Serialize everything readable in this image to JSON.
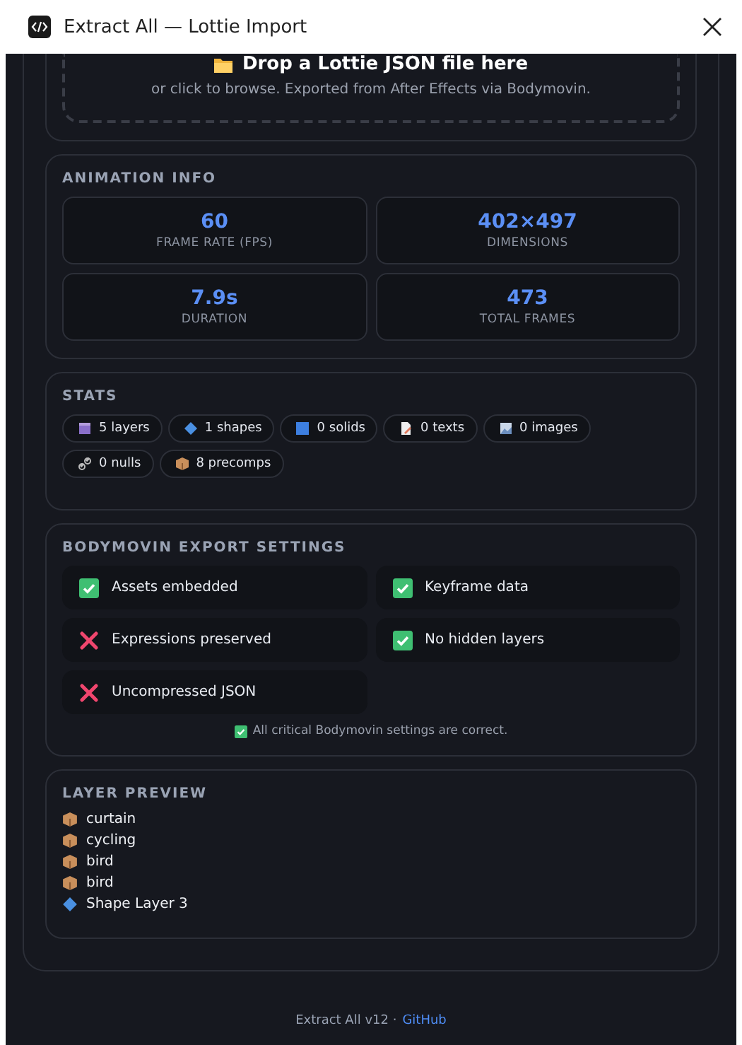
{
  "window": {
    "title": "Extract All — Lottie Import"
  },
  "dropzone": {
    "title": "Drop a Lottie JSON file here",
    "hint": "or click to browse. Exported from After Effects via Bodymovin."
  },
  "animation_info": {
    "heading": "ANIMATION INFO",
    "metrics": [
      {
        "value": "60",
        "label": "FRAME RATE (FPS)"
      },
      {
        "value": "402×497",
        "label": "DIMENSIONS"
      },
      {
        "value": "7.9s",
        "label": "DURATION"
      },
      {
        "value": "473",
        "label": "TOTAL FRAMES"
      }
    ]
  },
  "stats": {
    "heading": "STATS",
    "chips": [
      {
        "kind": "layers",
        "label": "5 layers"
      },
      {
        "kind": "shapes",
        "label": "1 shapes"
      },
      {
        "kind": "solids",
        "label": "0 solids"
      },
      {
        "kind": "texts",
        "label": "0 texts"
      },
      {
        "kind": "images",
        "label": "0 images"
      },
      {
        "kind": "nulls",
        "label": "0 nulls"
      },
      {
        "kind": "precomps",
        "label": "8 precomps"
      }
    ]
  },
  "export_settings": {
    "heading": "BODYMOVIN EXPORT SETTINGS",
    "items": [
      {
        "label": "Assets embedded",
        "checked": true
      },
      {
        "label": "Keyframe data",
        "checked": true
      },
      {
        "label": "Expressions preserved",
        "checked": false
      },
      {
        "label": "No hidden layers",
        "checked": true
      },
      {
        "label": "Uncompressed JSON",
        "checked": false
      }
    ],
    "summary": "All critical Bodymovin settings are correct."
  },
  "layer_preview": {
    "heading": "LAYER PREVIEW",
    "layers": [
      {
        "kind": "precomp",
        "name": "curtain"
      },
      {
        "kind": "precomp",
        "name": "cycling"
      },
      {
        "kind": "precomp",
        "name": "bird"
      },
      {
        "kind": "precomp",
        "name": "bird"
      },
      {
        "kind": "shape",
        "name": "Shape Layer 3"
      }
    ]
  },
  "footer": {
    "text": "Extract All v12 ·",
    "link": "GitHub"
  }
}
